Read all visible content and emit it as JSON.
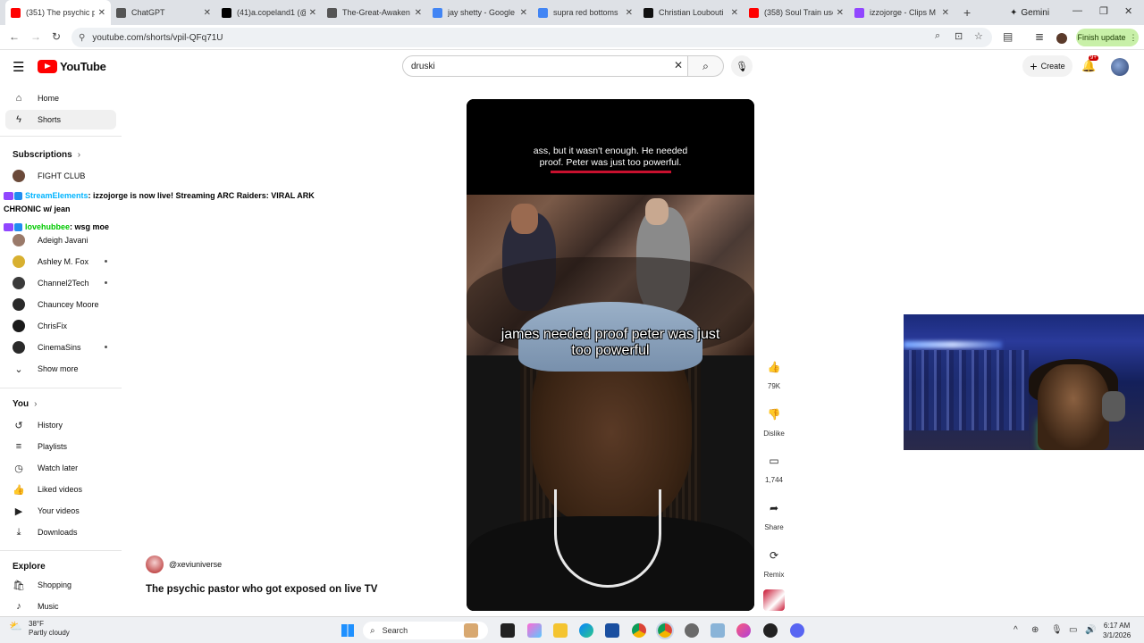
{
  "browser": {
    "tabs": [
      {
        "title": "(351) The psychic p",
        "favicon": "youtube-icon",
        "color": "#ff0000",
        "active": true
      },
      {
        "title": "ChatGPT",
        "favicon": "chatgpt-icon",
        "color": "#555555",
        "active": false
      },
      {
        "title": "(41)a.copeland1 (@",
        "favicon": "tiktok-icon",
        "color": "#000000",
        "active": false
      },
      {
        "title": "The-Great-Awaken",
        "favicon": "rumble-icon",
        "color": "#555555",
        "active": false
      },
      {
        "title": "jay shetty - Google",
        "favicon": "google-icon",
        "color": "#4285f4",
        "active": false
      },
      {
        "title": "supra red bottoms",
        "favicon": "google-icon",
        "color": "#4285f4",
        "active": false
      },
      {
        "title": "Christian Loubouti",
        "favicon": "site-icon",
        "color": "#111111",
        "active": false
      },
      {
        "title": "(358) Soul Train use",
        "favicon": "youtube-icon",
        "color": "#ff0000",
        "active": false
      },
      {
        "title": "izzojorge - Clips M",
        "favicon": "twitch-icon",
        "color": "#9146ff",
        "active": false
      }
    ],
    "new_tab": "+",
    "gemini": "Gemini",
    "url": "youtube.com/shorts/vpil-QFq71U",
    "finish_update": "Finish update"
  },
  "youtube": {
    "logo_text": "YouTube",
    "search_query": "druski",
    "create_label": "Create",
    "notification_badge": "9+"
  },
  "sidebar": {
    "top": [
      {
        "label": "Home",
        "icon": "home-icon",
        "glyph": "⌂"
      },
      {
        "label": "Shorts",
        "icon": "shorts-icon",
        "glyph": "ϟ"
      }
    ],
    "subscriptions_heading": "Subscriptions",
    "subscriptions": [
      {
        "label": "FIGHT CLUB",
        "color": "#6b4a3a",
        "live": false
      },
      {
        "label": "Adeigh Javani",
        "color": "#9a7a6a",
        "live": false
      },
      {
        "label": "Ashley M. Fox",
        "color": "#d8b030",
        "live": true
      },
      {
        "label": "Channel2Tech",
        "color": "#3a3a3a",
        "live": true
      },
      {
        "label": "Chauncey Moore",
        "color": "#2a2a2a",
        "live": false
      },
      {
        "label": "ChrisFix",
        "color": "#1a1a1a",
        "live": false
      },
      {
        "label": "CinemaSins",
        "color": "#2a2a2a",
        "live": true
      }
    ],
    "show_more": "Show more",
    "you_heading": "You",
    "you": [
      {
        "label": "History",
        "icon": "history-icon",
        "glyph": "↺"
      },
      {
        "label": "Playlists",
        "icon": "playlists-icon",
        "glyph": "≡"
      },
      {
        "label": "Watch later",
        "icon": "watch-later-icon",
        "glyph": "◷"
      },
      {
        "label": "Liked videos",
        "icon": "like-icon",
        "glyph": "👍"
      },
      {
        "label": "Your videos",
        "icon": "your-videos-icon",
        "glyph": "▶"
      },
      {
        "label": "Downloads",
        "icon": "download-icon",
        "glyph": "⤓"
      }
    ],
    "explore_heading": "Explore",
    "explore": [
      {
        "label": "Shopping",
        "icon": "shopping-icon",
        "glyph": "🛍"
      },
      {
        "label": "Music",
        "icon": "music-icon",
        "glyph": "♪"
      }
    ]
  },
  "chat_overlay": {
    "line1_user": "StreamElements",
    "line1_text": ": izzojorge is now live! Streaming ARC Raiders: VIRAL ARK",
    "line1_cont": "CHRONIC w/ jean",
    "line2_user": "lovehubbee",
    "line2_text": ": wsg moe"
  },
  "video": {
    "caption_top": "ass, but it wasn't enough. He needed proof. Peter was just too powerful.",
    "caption_main": "james needed proof peter was just too powerful",
    "channel": "@xeviuniverse",
    "title": "The psychic pastor who got exposed on live TV"
  },
  "actions": {
    "likes": "79K",
    "dislike": "Dislike",
    "comments": "1,744",
    "share": "Share",
    "remix": "Remix"
  },
  "taskbar": {
    "temperature": "38°F",
    "weather": "Partly cloudy",
    "search": "Search",
    "time": "6:17 AM",
    "date": "3/1/2026"
  }
}
